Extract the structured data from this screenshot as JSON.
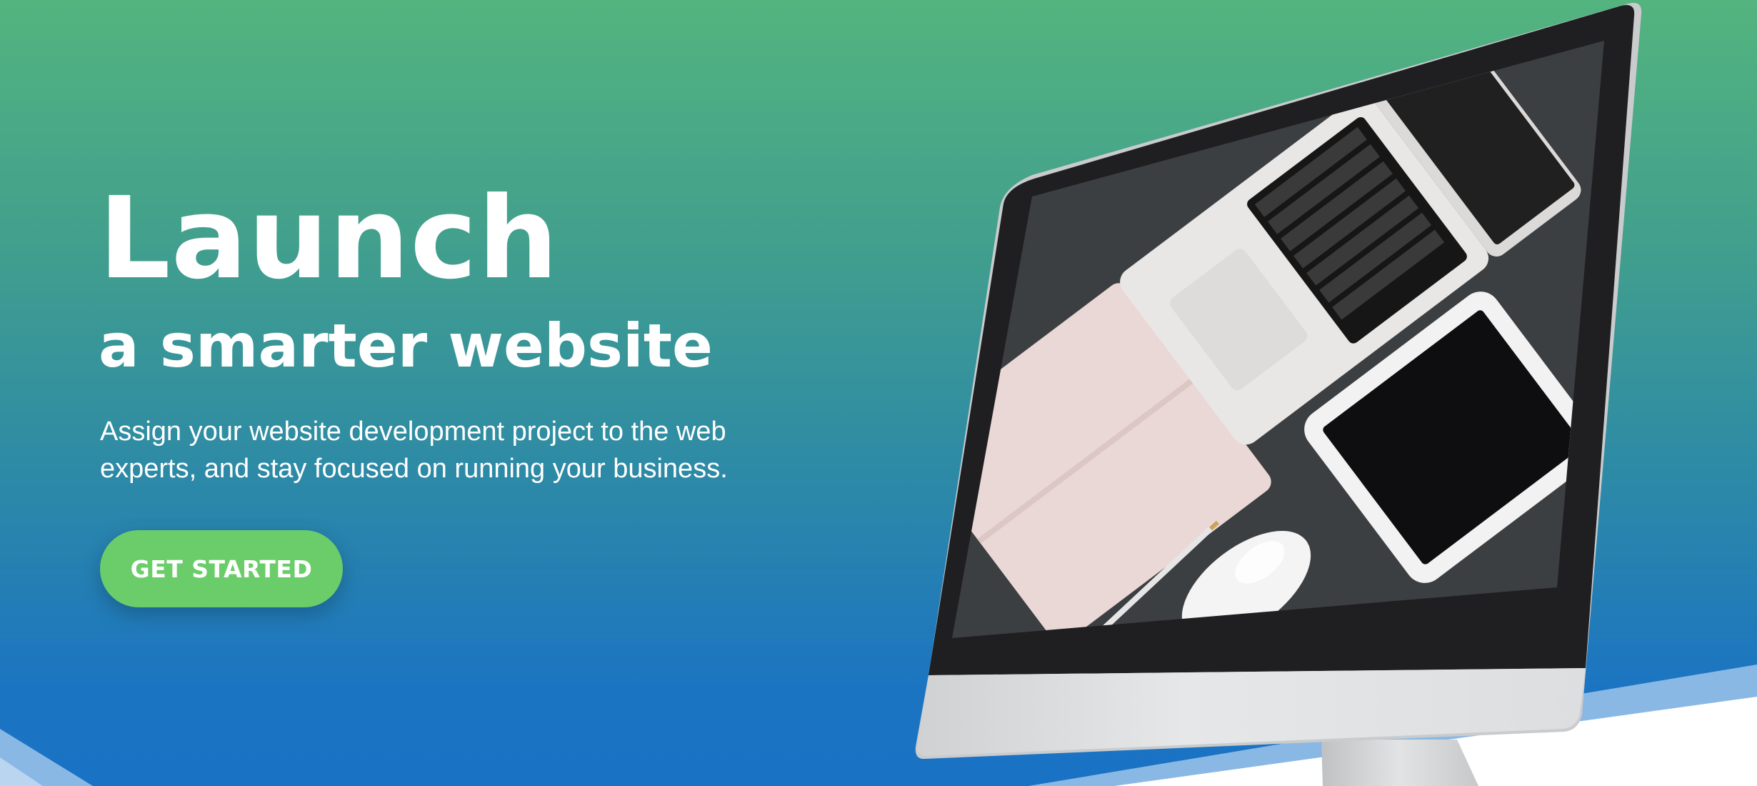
{
  "hero": {
    "headline": "Launch",
    "subheadline": "a smarter website",
    "description": "Assign your website development project to the web experts, and stay focused on running your business.",
    "cta_label": "GET STARTED"
  },
  "colors": {
    "gradient_top": "#53b47f",
    "gradient_bottom": "#1a72c4",
    "cta_background": "#6acd6a",
    "text": "#ffffff",
    "bottom_wave": "#ffffff",
    "wave_accent": "#8ab8e4"
  },
  "illustration": {
    "device": "imac-monitor",
    "screen_image": "flat-lay desk photo with laptop, tablet, notebook, pencil and mouse"
  }
}
